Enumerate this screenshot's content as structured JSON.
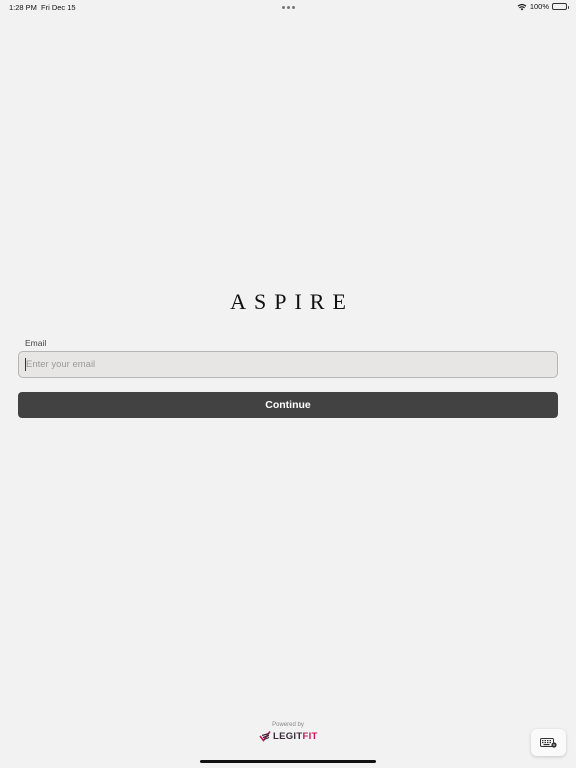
{
  "status_bar": {
    "time": "1:28 PM",
    "date": "Fri Dec 15",
    "battery": "100%",
    "wifi_icon": "wifi-icon",
    "battery_icon": "battery-icon"
  },
  "brand": {
    "logo_text": "ASPIRE"
  },
  "form": {
    "email_label": "Email",
    "email_placeholder": "Enter your email",
    "email_value": "",
    "continue_label": "Continue"
  },
  "footer": {
    "powered_by": "Powered by",
    "legitfit_legit": "LEGIT",
    "legitfit_fit": "FIT",
    "brand_colors": {
      "legit": "#3a2a3a",
      "fit": "#c2185b"
    }
  },
  "colors": {
    "background": "#f2f2f2",
    "button": "#424242",
    "input_background": "#e7e6e4"
  },
  "icons": {
    "keyboard": "keyboard-icon"
  }
}
